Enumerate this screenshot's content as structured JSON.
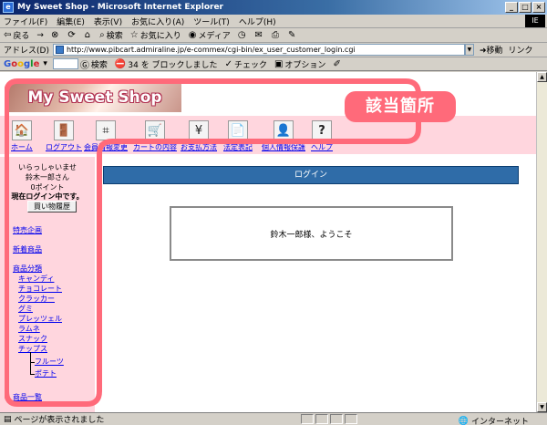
{
  "window": {
    "title": "My Sweet Shop - Microsoft Internet Explorer",
    "min": "_",
    "max": "□",
    "close": "×",
    "ielogo": "IE"
  },
  "menubar": [
    "ファイル(F)",
    "編集(E)",
    "表示(V)",
    "お気に入り(A)",
    "ツール(T)",
    "ヘルプ(H)"
  ],
  "toolbar": {
    "back": "戻る",
    "forward": "→",
    "search": "検索",
    "favorites": "お気に入り",
    "media": "メディア"
  },
  "address": {
    "label": "アドレス(D)",
    "url": "http://www.pibcart.admiraline.jp/e-commex/cgi-bin/ex_user_customer_login.cgi",
    "go": "移動",
    "links": "リンク"
  },
  "google_toolbar": {
    "logo": [
      "G",
      "o",
      "o",
      "g",
      "l",
      "e"
    ],
    "search": "検索",
    "popups": "34 を ブロックしました",
    "check": "チェック",
    "options": "オプション"
  },
  "page": {
    "shop_name": "My Sweet Shop",
    "nav": [
      {
        "label": "ホーム",
        "icon": "🏠"
      },
      {
        "label": "ログアウト",
        "icon": "🚪"
      },
      {
        "label": "会員情報変更",
        "icon": "⌗"
      },
      {
        "label": "カートの内容",
        "icon": "🛒"
      },
      {
        "label": "お支払方法",
        "icon": "¥"
      },
      {
        "label": "法定表記",
        "icon": "📄"
      },
      {
        "label": "個人情報保護",
        "icon": "👤"
      },
      {
        "label": "ヘルプ",
        "icon": "?"
      }
    ],
    "sidebar": {
      "greeting": "いらっしゃいませ",
      "user": "鈴木一郎さん",
      "points": "0ポイント",
      "login_status": "現在ログイン中です。",
      "history_button": "買い物履歴",
      "special": "特売企画",
      "new_products": "新着商品",
      "categories_title": "商品分類",
      "categories": [
        "キャンディ",
        "チョコレート",
        "クラッカー",
        "グミ",
        "プレッツェル",
        "ラムネ",
        "スナック",
        "チップス"
      ],
      "subcategories": [
        "フルーツ",
        "ポテト"
      ],
      "product_list": "商品一覧"
    },
    "login_title": "ログイン",
    "welcome": "鈴木一郎様、ようこそ"
  },
  "annotation": {
    "label": "該当箇所",
    "color": "#ff6a7a"
  },
  "status": {
    "text": "ページが表示されました",
    "zone": "インターネット"
  }
}
